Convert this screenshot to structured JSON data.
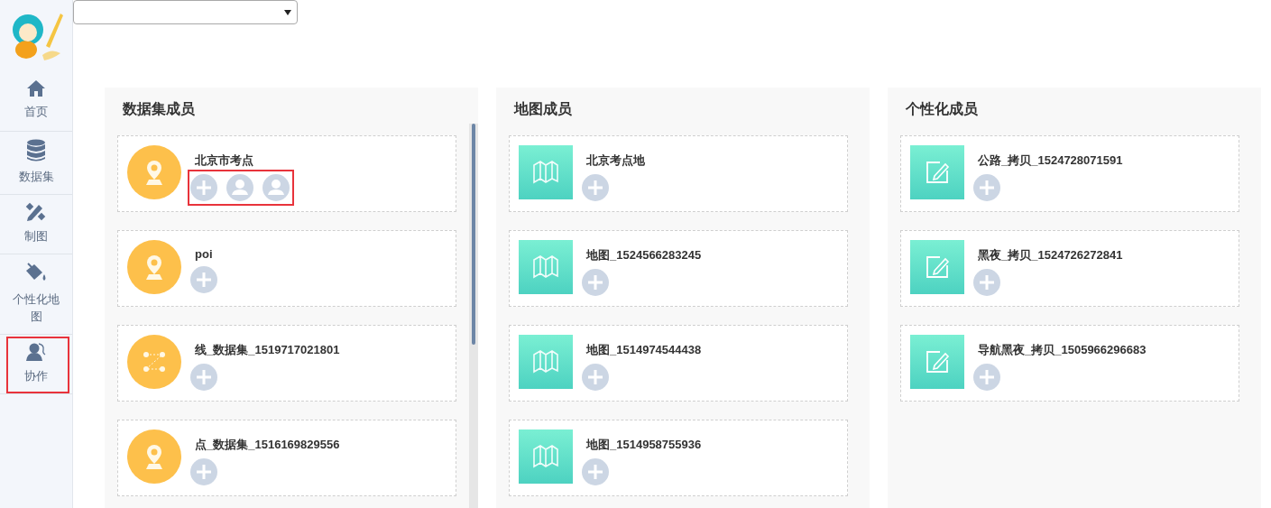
{
  "sidebar": {
    "items": [
      {
        "label": "首页",
        "highlighted": false
      },
      {
        "label": "数据集",
        "highlighted": false
      },
      {
        "label": "制图",
        "highlighted": false
      },
      {
        "label": "个性化地图",
        "highlighted": false
      },
      {
        "label": "协作",
        "highlighted": true
      }
    ]
  },
  "panels": [
    {
      "title": "数据集成员",
      "kind": "dataset",
      "members": [
        {
          "name": "北京市考点",
          "kind": "point",
          "highlighted": true,
          "avatars": [
            {
              "kind": "add"
            },
            {
              "kind": "user"
            },
            {
              "kind": "user"
            }
          ]
        },
        {
          "name": "poi",
          "kind": "point",
          "highlighted": false,
          "avatars": [
            {
              "kind": "add"
            }
          ]
        },
        {
          "name": "线_数据集_1519717021801",
          "kind": "line",
          "highlighted": false,
          "avatars": [
            {
              "kind": "add"
            }
          ]
        },
        {
          "name": "点_数据集_1516169829556",
          "kind": "point",
          "highlighted": false,
          "avatars": [
            {
              "kind": "add"
            }
          ]
        }
      ]
    },
    {
      "title": "地图成员",
      "kind": "map",
      "members": [
        {
          "name": "北京考点地",
          "kind": "map",
          "highlighted": false,
          "avatars": [
            {
              "kind": "add"
            }
          ]
        },
        {
          "name": "地图_1524566283245",
          "kind": "map",
          "highlighted": false,
          "avatars": [
            {
              "kind": "add"
            }
          ]
        },
        {
          "name": "地图_1514974544438",
          "kind": "map",
          "highlighted": false,
          "avatars": [
            {
              "kind": "add"
            }
          ]
        },
        {
          "name": "地图_1514958755936",
          "kind": "map",
          "highlighted": false,
          "avatars": [
            {
              "kind": "add"
            }
          ]
        }
      ]
    },
    {
      "title": "个性化成员",
      "kind": "style",
      "members": [
        {
          "name": "公路_拷贝_1524728071591",
          "kind": "edit",
          "highlighted": false,
          "avatars": [
            {
              "kind": "add"
            }
          ]
        },
        {
          "name": "黑夜_拷贝_1524726272841",
          "kind": "edit",
          "highlighted": false,
          "avatars": [
            {
              "kind": "add"
            }
          ]
        },
        {
          "name": "导航黑夜_拷贝_1505966296683",
          "kind": "edit",
          "highlighted": false,
          "avatars": [
            {
              "kind": "add"
            }
          ]
        }
      ]
    }
  ]
}
